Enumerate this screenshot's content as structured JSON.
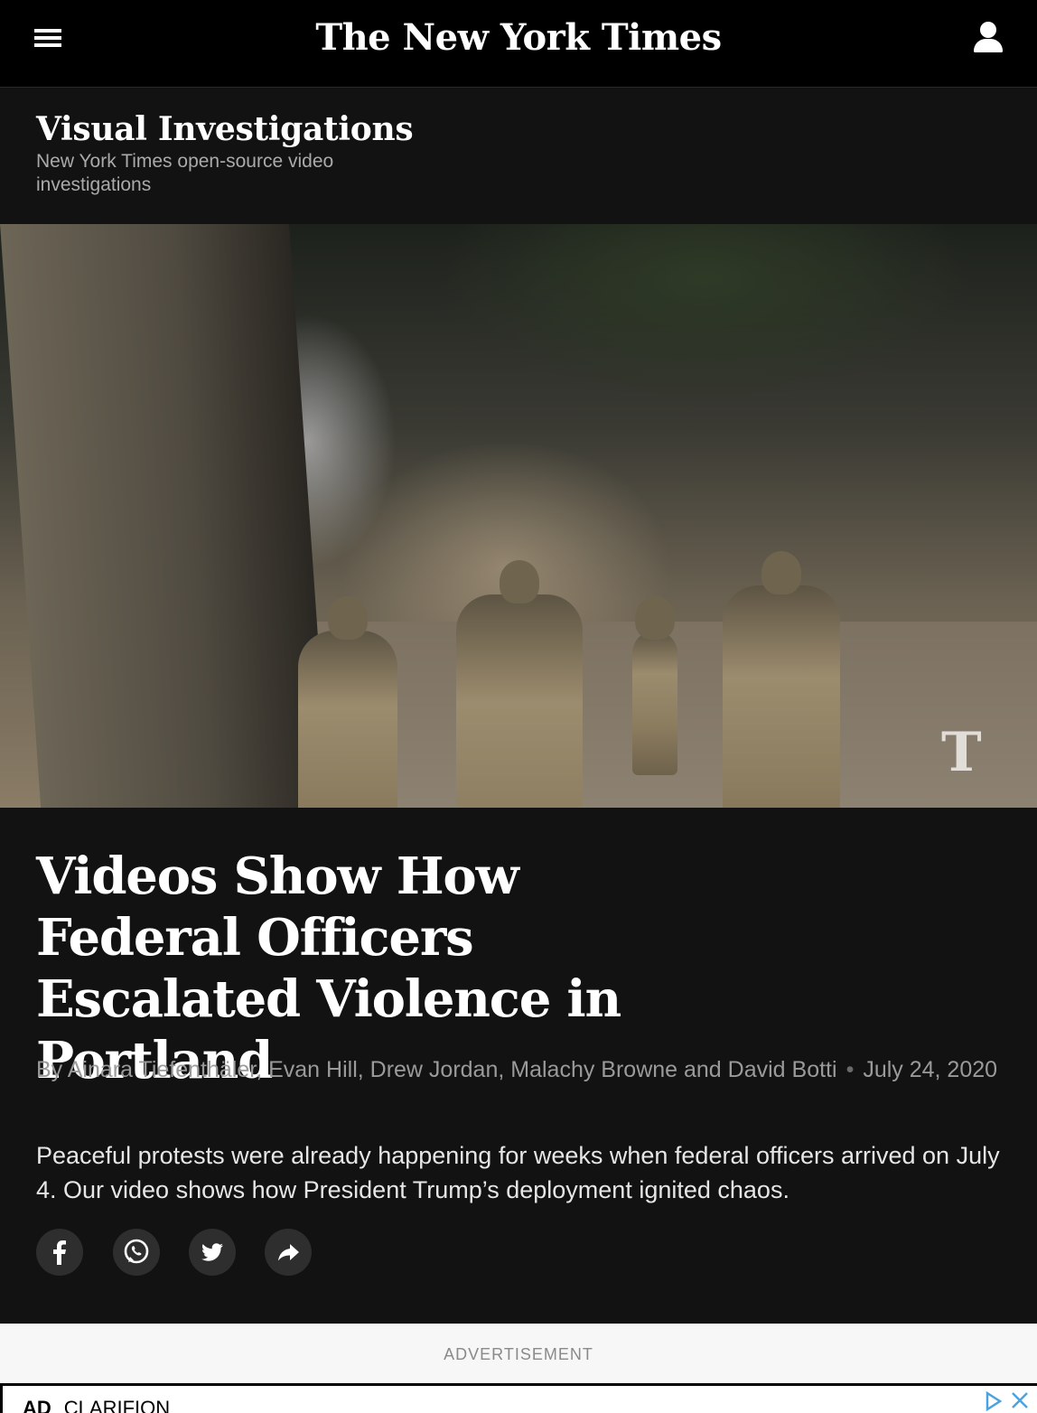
{
  "header": {
    "logo": "The New York Times",
    "menu_icon": "hamburger-menu-icon",
    "user_icon": "user-account-icon"
  },
  "section": {
    "title": "Visual Investigations",
    "subtitle": "New York Times open-source video investigations"
  },
  "hero": {
    "watermark": "T"
  },
  "article": {
    "headline": "Videos Show How Federal Officers Escalated Violence in Portland",
    "byline": "By Ainara Tiefenthäler, Evan Hill, Drew Jordan, Malachy Browne and David Botti",
    "date": "July 24, 2020",
    "summary": "Peaceful protests were already happening for weeks when federal officers arrived on July 4. Our video shows how President Trump’s deployment ignited chaos."
  },
  "share": [
    {
      "name": "facebook",
      "icon": "facebook-icon"
    },
    {
      "name": "whatsapp",
      "icon": "whatsapp-icon"
    },
    {
      "name": "twitter",
      "icon": "twitter-icon"
    },
    {
      "name": "more",
      "icon": "share-arrow-icon"
    }
  ],
  "ad": {
    "label": "ADVERTISEMENT",
    "badge": "AD",
    "text": "CLARIFION"
  },
  "colors": {
    "background": "#121212",
    "topbar": "#000000",
    "ad_background": "#f7f7f7"
  }
}
